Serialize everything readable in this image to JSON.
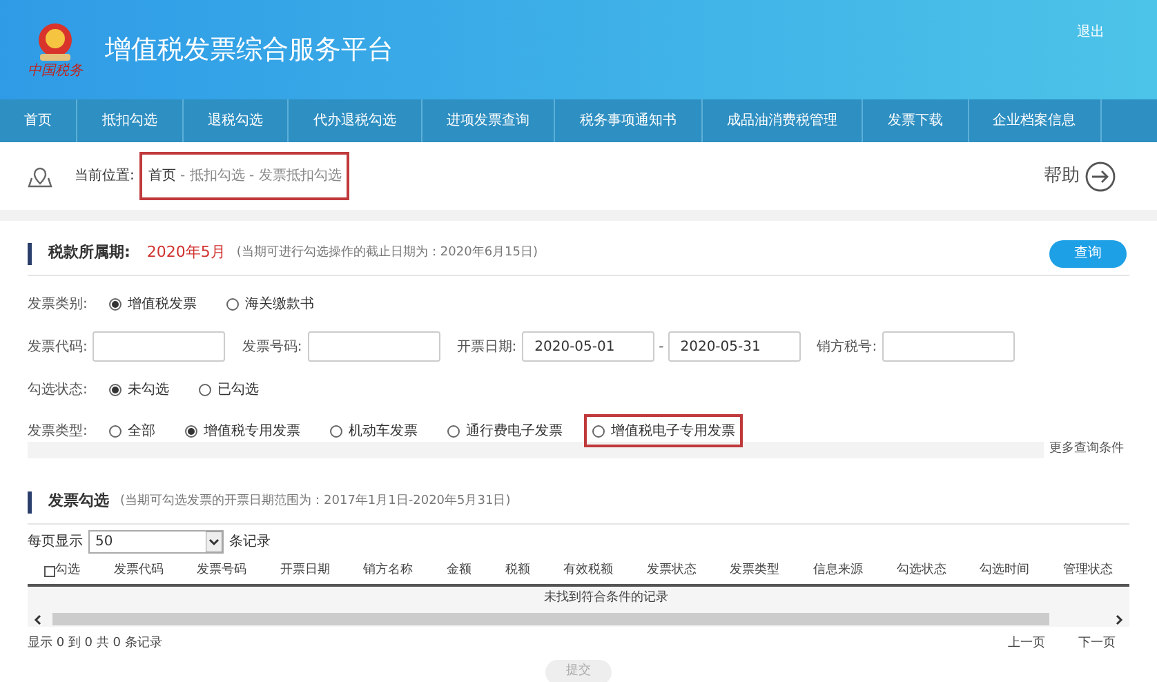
{
  "header": {
    "title": "增值税发票综合服务平台",
    "logo_caption": "中国税务",
    "logout": "退出"
  },
  "nav": [
    {
      "label": "首页",
      "selected": false
    },
    {
      "label": "抵扣勾选",
      "selected": false
    },
    {
      "label": "退税勾选",
      "selected": false
    },
    {
      "label": "代办退税勾选",
      "selected": false
    },
    {
      "label": "进项发票查询",
      "selected": false
    },
    {
      "label": "税务事项通知书",
      "selected": false
    },
    {
      "label": "成品油消费税管理",
      "selected": false
    },
    {
      "label": "发票下载",
      "selected": false
    },
    {
      "label": "企业档案信息",
      "selected": false
    }
  ],
  "breadcrumb": {
    "label": "当前位置:",
    "highlighted": true,
    "items": [
      "首页",
      "抵扣勾选",
      "发票抵扣勾选"
    ],
    "separator": " - "
  },
  "help": "帮助",
  "period": {
    "label": "税款所属期:",
    "value": "2020年5月",
    "note": "(当期可进行勾选操作的截止日期为：2020年6月15日)",
    "button": "查询"
  },
  "filters": {
    "category": {
      "label": "发票类别:",
      "options": [
        {
          "label": "增值税发票",
          "selected": true,
          "highlighted": false
        },
        {
          "label": "海关缴款书",
          "selected": false,
          "highlighted": false
        }
      ]
    },
    "code": {
      "label": "发票代码:"
    },
    "number": {
      "label": "发票号码:"
    },
    "date": {
      "label": "开票日期:",
      "from": "2020-05-01",
      "dash": "-",
      "to": "2020-05-31"
    },
    "seller": {
      "label": "销方税号:"
    },
    "status": {
      "label": "勾选状态:",
      "options": [
        {
          "label": "未勾选",
          "selected": true,
          "highlighted": false
        },
        {
          "label": "已勾选",
          "selected": false,
          "highlighted": false
        }
      ]
    },
    "type": {
      "label": "发票类型:",
      "options": [
        {
          "label": "全部",
          "selected": false,
          "highlighted": false
        },
        {
          "label": "增值税专用发票",
          "selected": true,
          "highlighted": false
        },
        {
          "label": "机动车发票",
          "selected": false,
          "highlighted": false
        },
        {
          "label": "通行费电子发票",
          "selected": false,
          "highlighted": false
        },
        {
          "label": "增值税电子专用发票",
          "selected": false,
          "highlighted": true
        }
      ]
    },
    "more": "更多查询条件"
  },
  "list": {
    "title": "发票勾选",
    "note": "(当期可勾选发票的开票日期范围为：2017年1月1日-2020年5月31日)",
    "page_size_label": "每页显示",
    "page_size": "50",
    "records_label": "条记录",
    "select_all_checked": false,
    "columns": [
      "勾选",
      "发票代码",
      "发票号码",
      "开票日期",
      "销方名称",
      "金额",
      "税额",
      "有效税额",
      "发票状态",
      "发票类型",
      "信息来源",
      "勾选状态",
      "勾选时间",
      "管理状态"
    ],
    "empty": "未找到符合条件的记录",
    "summary": "显示 0 到 0 共 0 条记录",
    "prev": "上一页",
    "next": "下一页",
    "submit": "提交"
  }
}
